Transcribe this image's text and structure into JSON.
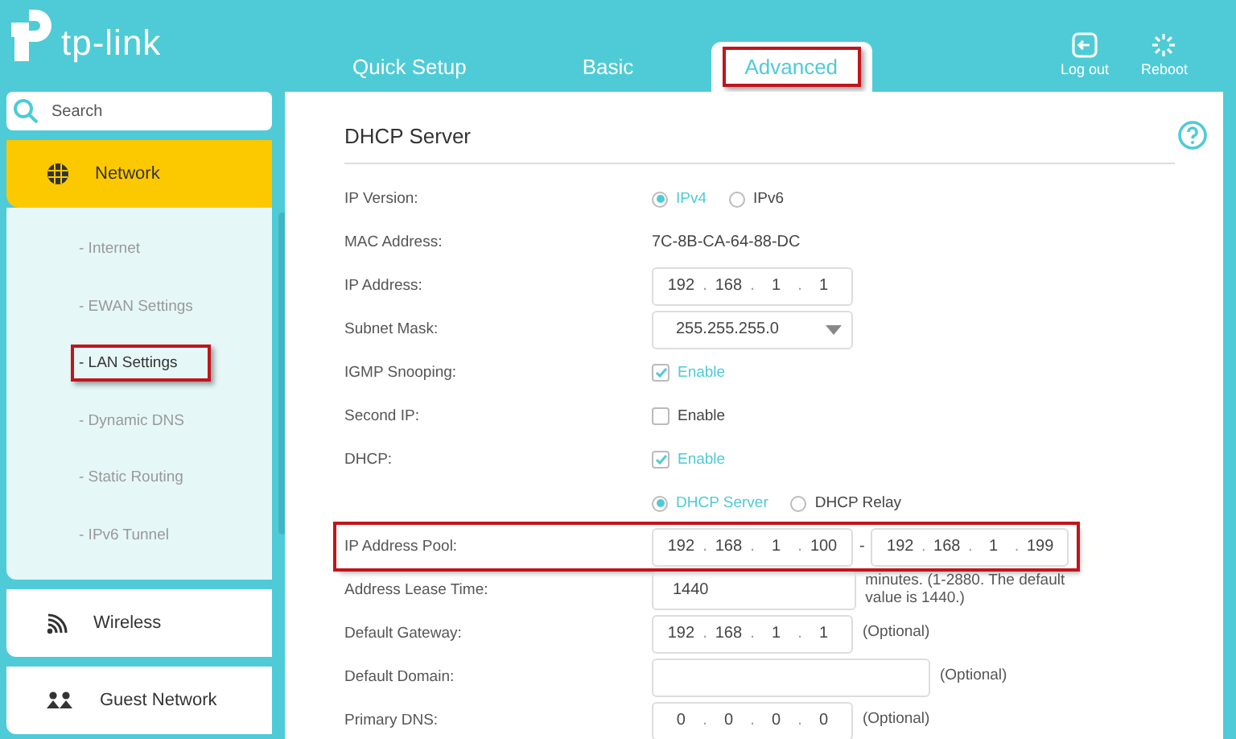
{
  "brand": "tp-link",
  "tabs": [
    {
      "label": "Quick Setup",
      "selected": false,
      "highlighted": false
    },
    {
      "label": "Basic",
      "selected": false,
      "highlighted": false
    },
    {
      "label": "Advanced",
      "selected": true,
      "highlighted": true
    }
  ],
  "header_actions": [
    {
      "kind": "logout",
      "label": "Log out"
    },
    {
      "kind": "reboot",
      "label": "Reboot"
    }
  ],
  "search": {
    "placeholder": "Search"
  },
  "sidebar": {
    "items": [
      {
        "kind": "network",
        "label": "Network",
        "expanded": true,
        "children": [
          {
            "label": "- Internet",
            "selected": false,
            "highlighted": false
          },
          {
            "label": "- EWAN Settings",
            "selected": false,
            "highlighted": false
          },
          {
            "label": "- LAN Settings",
            "selected": true,
            "highlighted": true
          },
          {
            "label": "- Dynamic DNS",
            "selected": false,
            "highlighted": false
          },
          {
            "label": "- Static Routing",
            "selected": false,
            "highlighted": false
          },
          {
            "label": "- IPv6 Tunnel",
            "selected": false,
            "highlighted": false
          }
        ]
      },
      {
        "kind": "wireless",
        "label": "Wireless",
        "expanded": false
      },
      {
        "kind": "guest",
        "label": "Guest Network",
        "expanded": false
      }
    ]
  },
  "section": {
    "title": "DHCP Server"
  },
  "ip_separator": ".",
  "range_separator": "-",
  "fields": [
    {
      "kind": "radio",
      "label": "IP Version:",
      "options": [
        {
          "label": "IPv4",
          "selected": true
        },
        {
          "label": "IPv6",
          "selected": false
        }
      ]
    },
    {
      "kind": "text",
      "label": "MAC Address:",
      "value": "7C-8B-CA-64-88-DC"
    },
    {
      "kind": "ip",
      "label": "IP Address:",
      "octets": [
        "192",
        "168",
        "1",
        "1"
      ]
    },
    {
      "kind": "select",
      "label": "Subnet Mask:",
      "value": "255.255.255.0"
    },
    {
      "kind": "checkbox",
      "label": "IGMP Snooping:",
      "option": "Enable",
      "checked": true
    },
    {
      "kind": "checkbox",
      "label": "Second IP:",
      "option": "Enable",
      "checked": false
    },
    {
      "kind": "checkbox",
      "label": "DHCP:",
      "option": "Enable",
      "checked": true
    },
    {
      "kind": "radio",
      "options": [
        {
          "label": "DHCP Server",
          "selected": true
        },
        {
          "label": "DHCP Relay",
          "selected": false
        }
      ]
    },
    {
      "kind": "pool",
      "label": "IP Address Pool:",
      "highlighted": true,
      "start": [
        "192",
        "168",
        "1",
        "100"
      ],
      "end": [
        "192",
        "168",
        "1",
        "199"
      ]
    },
    {
      "kind": "input",
      "label": "Address Lease Time:",
      "value": "1440",
      "note": "minutes. (1-2880. The default value is 1440.)"
    },
    {
      "kind": "ip",
      "label": "Default Gateway:",
      "octets": [
        "192",
        "168",
        "1",
        "1"
      ],
      "note": "(Optional)"
    },
    {
      "kind": "input",
      "label": "Default Domain:",
      "note": "(Optional)"
    },
    {
      "kind": "ip",
      "label": "Primary DNS:",
      "octets": [
        "0",
        "0",
        "0",
        "0"
      ],
      "note": "(Optional)"
    }
  ]
}
